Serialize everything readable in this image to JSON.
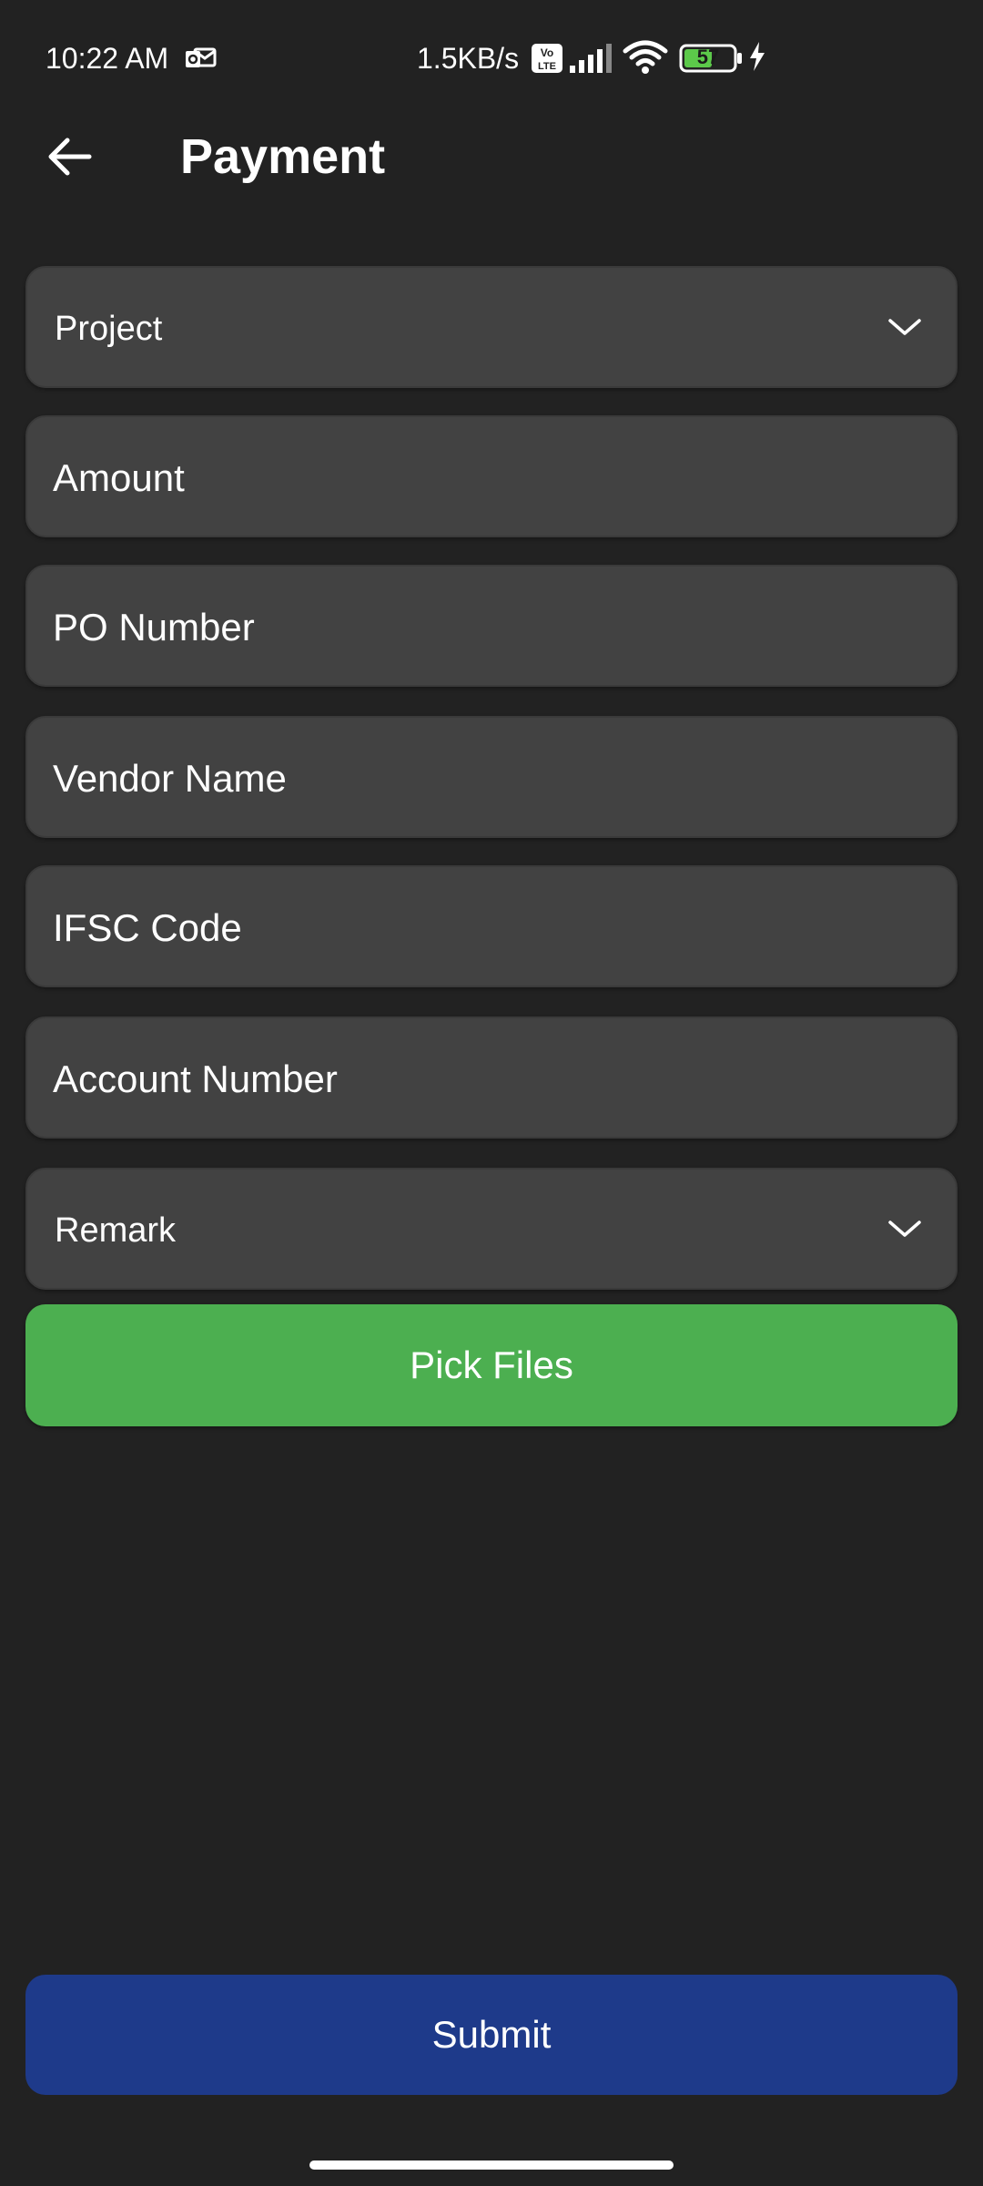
{
  "status_bar": {
    "time": "10:22 AM",
    "speed": "1.5KB/s",
    "battery": "57",
    "icons": {
      "notification": "outlook-mail-icon",
      "volte": "volte-icon",
      "signal": "signal-icon",
      "wifi": "wifi-icon",
      "battery": "battery-icon",
      "charging": "charging-bolt-icon"
    }
  },
  "header": {
    "title": "Payment",
    "back_icon": "arrow-left-icon"
  },
  "form": {
    "project": {
      "placeholder": "Project",
      "value": ""
    },
    "amount": {
      "placeholder": "Amount",
      "value": ""
    },
    "po_number": {
      "placeholder": "PO Number",
      "value": ""
    },
    "vendor_name": {
      "placeholder": "Vendor Name",
      "value": ""
    },
    "ifsc_code": {
      "placeholder": "IFSC Code",
      "value": ""
    },
    "account_number": {
      "placeholder": "Account Number",
      "value": ""
    },
    "remark": {
      "placeholder": "Remark",
      "value": ""
    }
  },
  "actions": {
    "pick_files_label": "Pick Files",
    "submit_label": "Submit"
  },
  "colors": {
    "background": "#222222",
    "field_background": "#424242",
    "pick_files": "#4caf50",
    "submit": "#1e3a8a",
    "battery_fill": "#5cc94a"
  }
}
